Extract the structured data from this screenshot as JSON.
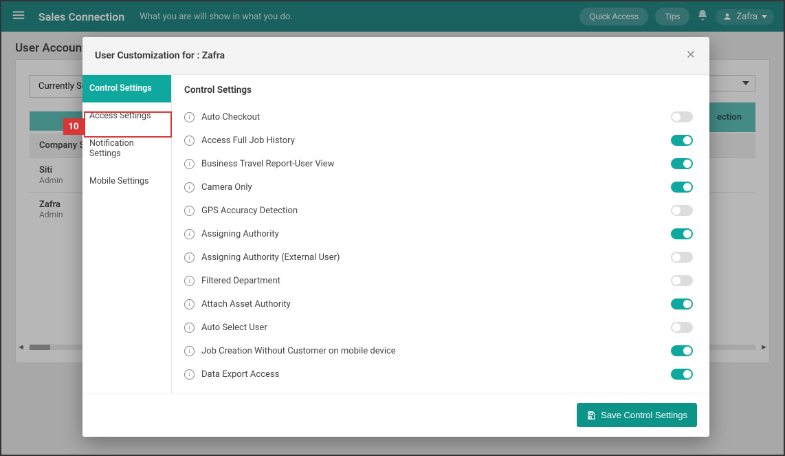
{
  "header": {
    "app_title": "Sales Connection",
    "tagline": "What you are will show in what you do.",
    "quick_access": "Quick Access",
    "tips": "Tips",
    "username": "Zafra"
  },
  "page": {
    "title": "User Account",
    "currently_selected_label": "Currently Se",
    "tab1": "",
    "tab2": "ection",
    "table_header": "Company S",
    "users": [
      {
        "name": "Siti",
        "role": "Admin"
      },
      {
        "name": "Zafra",
        "role": "Admin"
      }
    ]
  },
  "modal": {
    "title": "User Customization for : Zafra",
    "sidebar": [
      {
        "label": "Control Settings",
        "active": true
      },
      {
        "label": "Access Settings",
        "active": false
      },
      {
        "label": "Notification Settings",
        "active": false
      },
      {
        "label": "Mobile Settings",
        "active": false
      }
    ],
    "content_title": "Control Settings",
    "settings": [
      {
        "label": "Auto Checkout",
        "enabled": false
      },
      {
        "label": "Access Full Job History",
        "enabled": true
      },
      {
        "label": "Business Travel Report-User View",
        "enabled": true
      },
      {
        "label": "Camera Only",
        "enabled": true
      },
      {
        "label": "GPS Accuracy Detection",
        "enabled": false
      },
      {
        "label": "Assigning Authority",
        "enabled": true
      },
      {
        "label": "Assigning Authority (External User)",
        "enabled": false
      },
      {
        "label": "Filtered Department",
        "enabled": false
      },
      {
        "label": "Attach Asset Authority",
        "enabled": true
      },
      {
        "label": "Auto Select User",
        "enabled": false
      },
      {
        "label": "Job Creation Without Customer on mobile device",
        "enabled": true
      },
      {
        "label": "Data Export Access",
        "enabled": true
      }
    ],
    "save_label": "Save Control Settings"
  },
  "annotation": {
    "number": "10"
  }
}
